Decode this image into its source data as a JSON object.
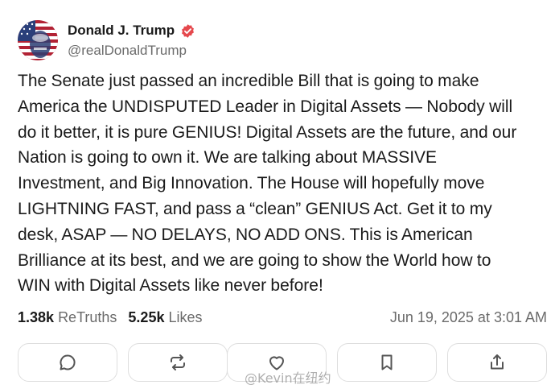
{
  "author": {
    "display_name": "Donald J. Trump",
    "handle": "@realDonaldTrump",
    "verified_icon": "verified-badge-icon",
    "verified_color": "#e5484d"
  },
  "post": {
    "lines": [
      "The Senate just passed an incredible Bill that is going to make",
      "America the UNDISPUTED Leader in Digital Assets — Nobody will",
      "do it better, it is pure GENIUS! Digital Assets are the future, and our",
      "Nation is going to own it. We are talking about MASSIVE",
      "Investment, and Big Innovation. The House will hopefully move",
      "LIGHTNING FAST, and pass a “clean” GENIUS Act. Get it to my",
      "desk, ASAP — NO DELAYS, NO ADD ONS. This is American",
      "Brilliance at its best, and we are going to show the World how to",
      "WIN with Digital Assets like never before!"
    ]
  },
  "stats": {
    "retruths_count": "1.38k",
    "retruths_label": "ReTruths",
    "likes_count": "5.25k",
    "likes_label": "Likes",
    "timestamp": "Jun 19, 2025 at 3:01 AM"
  },
  "actions": [
    {
      "name": "reply-button",
      "icon": "comment-icon"
    },
    {
      "name": "retruth-button",
      "icon": "repost-icon"
    },
    {
      "name": "like-button",
      "icon": "heart-icon"
    },
    {
      "name": "bookmark-button",
      "icon": "bookmark-icon"
    },
    {
      "name": "share-button",
      "icon": "share-icon"
    }
  ],
  "watermark": "@Kevin在纽约"
}
